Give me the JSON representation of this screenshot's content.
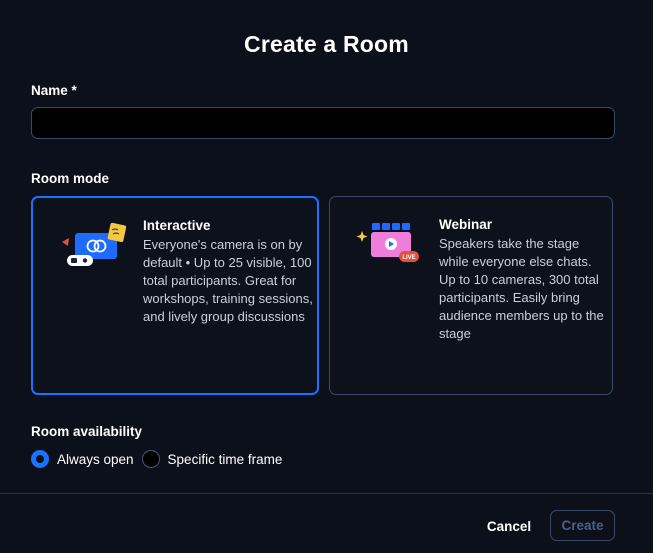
{
  "dialog": {
    "title": "Create a Room"
  },
  "name_field": {
    "label": "Name *",
    "value": "",
    "placeholder": ""
  },
  "room_mode": {
    "label": "Room mode",
    "selected": "Interactive",
    "options": [
      {
        "title": "Interactive",
        "description": "Everyone's camera is on by default • Up to 25 visible, 100 total participants. Great for workshops, training sessions, and lively group discussions",
        "icon": "interactive-room-illustration-icon"
      },
      {
        "title": "Webinar",
        "description": "Speakers take the stage while everyone else chats. Up to 10 cameras, 300 total participants. Easily bring audience members up to the stage",
        "icon": "webinar-room-illustration-icon",
        "badge": "LIVE"
      }
    ]
  },
  "availability": {
    "label": "Room availability",
    "selected": "Always open",
    "options": [
      "Always open",
      "Specific time frame"
    ]
  },
  "footer": {
    "cancel_label": "Cancel",
    "create_label": "Create"
  },
  "colors": {
    "accent": "#1a73ff",
    "background": "#0c101a",
    "border": "#3a4a66",
    "disabled_text": "#4a5f85"
  }
}
